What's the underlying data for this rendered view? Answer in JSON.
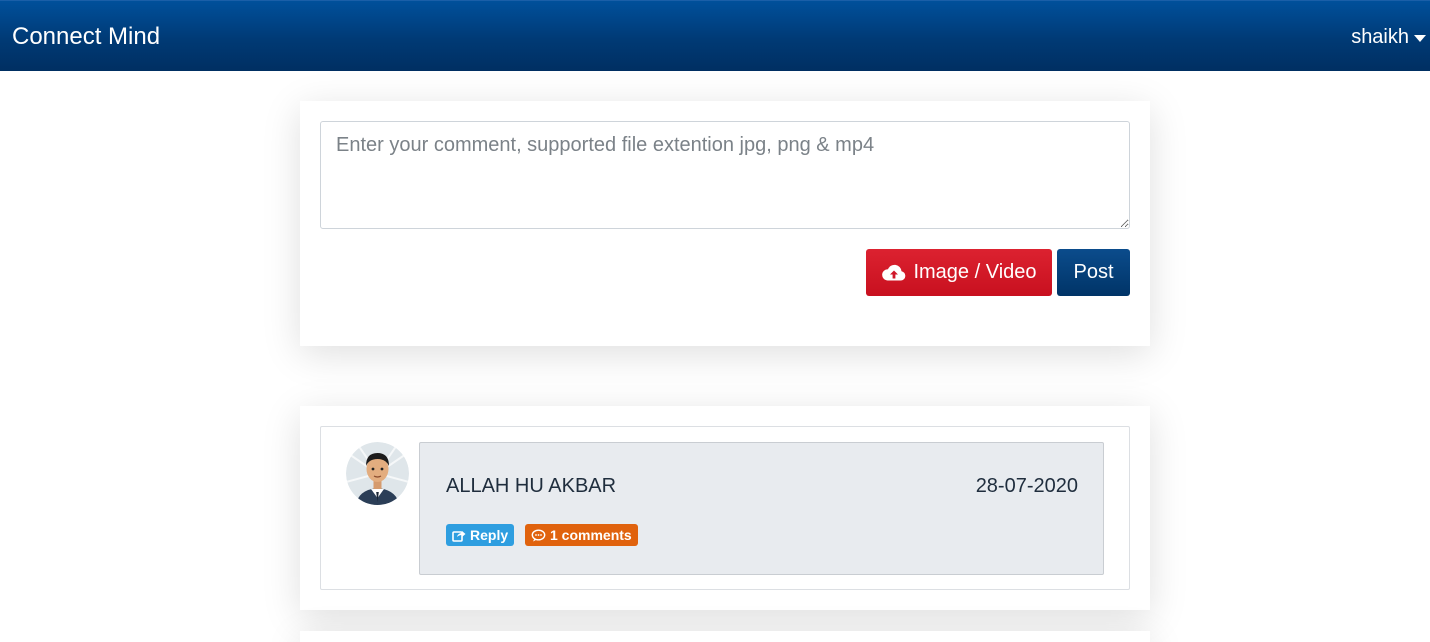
{
  "navbar": {
    "brand": "Connect Mind",
    "user": "shaikh"
  },
  "composer": {
    "placeholder": "Enter your comment, supported file extention jpg, png & mp4",
    "value": "",
    "upload_label": "Image / Video",
    "post_label": "Post"
  },
  "feed": {
    "posts": [
      {
        "text": "ALLAH HU AKBAR",
        "date": "28-07-2020",
        "reply_label": "Reply",
        "comments_label": "1 comments"
      }
    ]
  },
  "icons": {
    "upload": "cloud-upload-icon",
    "reply": "share-icon",
    "comments": "comment-icon",
    "user_caret": "caret-down-icon"
  },
  "colors": {
    "navbar": "#003f7d",
    "upload_button": "#d0172a",
    "post_button": "#0a3f78",
    "reply_badge": "#2e9ee0",
    "comments_badge": "#e0620d",
    "post_bubble": "#e8ebef"
  }
}
